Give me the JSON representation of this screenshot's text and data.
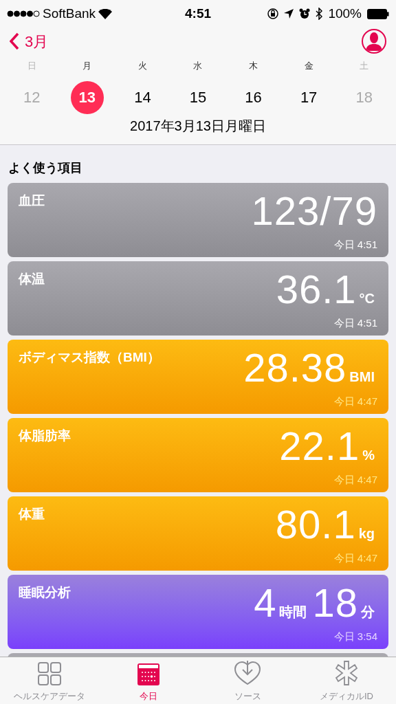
{
  "status_bar": {
    "carrier": "SoftBank",
    "time": "4:51",
    "battery": "100%"
  },
  "nav": {
    "back": "3月"
  },
  "week": [
    {
      "weekday": "日",
      "date": "12",
      "selected": false,
      "muted": true
    },
    {
      "weekday": "月",
      "date": "13",
      "selected": true,
      "muted": false
    },
    {
      "weekday": "火",
      "date": "14",
      "selected": false,
      "muted": false
    },
    {
      "weekday": "水",
      "date": "15",
      "selected": false,
      "muted": false
    },
    {
      "weekday": "木",
      "date": "16",
      "selected": false,
      "muted": false
    },
    {
      "weekday": "金",
      "date": "17",
      "selected": false,
      "muted": false
    },
    {
      "weekday": "土",
      "date": "18",
      "selected": false,
      "muted": true
    }
  ],
  "date_label": "2017年3月13日月曜日",
  "section_title": "よく使う項目",
  "cards": [
    {
      "kind": "gray",
      "title": "血圧",
      "value": [
        {
          "kind": "number",
          "text": "123/79"
        }
      ],
      "time": "今日 4:51"
    },
    {
      "kind": "gray",
      "title": "体温",
      "value": [
        {
          "kind": "number",
          "text": "36.1"
        },
        {
          "kind": "unit",
          "text": "°C"
        }
      ],
      "time": "今日 4:51"
    },
    {
      "kind": "orange",
      "title": "ボディマス指数（BMI）",
      "value": [
        {
          "kind": "number",
          "text": "28.38"
        },
        {
          "kind": "unit",
          "text": "BMI"
        }
      ],
      "time": "今日 4:47"
    },
    {
      "kind": "orange",
      "title": "体脂肪率",
      "value": [
        {
          "kind": "number",
          "text": "22.1"
        },
        {
          "kind": "unit",
          "text": "%"
        }
      ],
      "time": "今日 4:47"
    },
    {
      "kind": "orange",
      "title": "体重",
      "value": [
        {
          "kind": "number",
          "text": "80.1"
        },
        {
          "kind": "unit",
          "text": "kg"
        }
      ],
      "time": "今日 4:47"
    },
    {
      "kind": "purple",
      "title": "睡眠分析",
      "value": [
        {
          "kind": "number",
          "text": "4"
        },
        {
          "kind": "unit",
          "text": "時間"
        },
        {
          "kind": "number",
          "text": "18"
        },
        {
          "kind": "unit",
          "text": "分"
        }
      ],
      "time": "今日 3:54"
    }
  ],
  "tabs": [
    {
      "kind": "grid",
      "label": "ヘルスケアデータ",
      "selected": false
    },
    {
      "kind": "calendar",
      "label": "今日",
      "selected": true
    },
    {
      "kind": "heart",
      "label": "ソース",
      "selected": false
    },
    {
      "kind": "asterisk",
      "label": "メディカルID",
      "selected": false
    }
  ]
}
